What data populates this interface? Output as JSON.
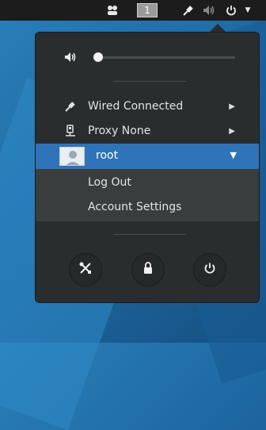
{
  "topbar": {
    "workspace_number": "1"
  },
  "menu": {
    "volume": {
      "level": 0.0
    },
    "network": {
      "label": "Wired Connected"
    },
    "proxy": {
      "label": "Proxy None"
    },
    "user": {
      "name": "root"
    },
    "user_menu": {
      "logout": "Log Out",
      "account_settings": "Account Settings"
    }
  },
  "colors": {
    "panel_bg": "#2a2d2e",
    "accent_blue": "#2f73b8",
    "topbar_bg": "#1c1c1c"
  }
}
